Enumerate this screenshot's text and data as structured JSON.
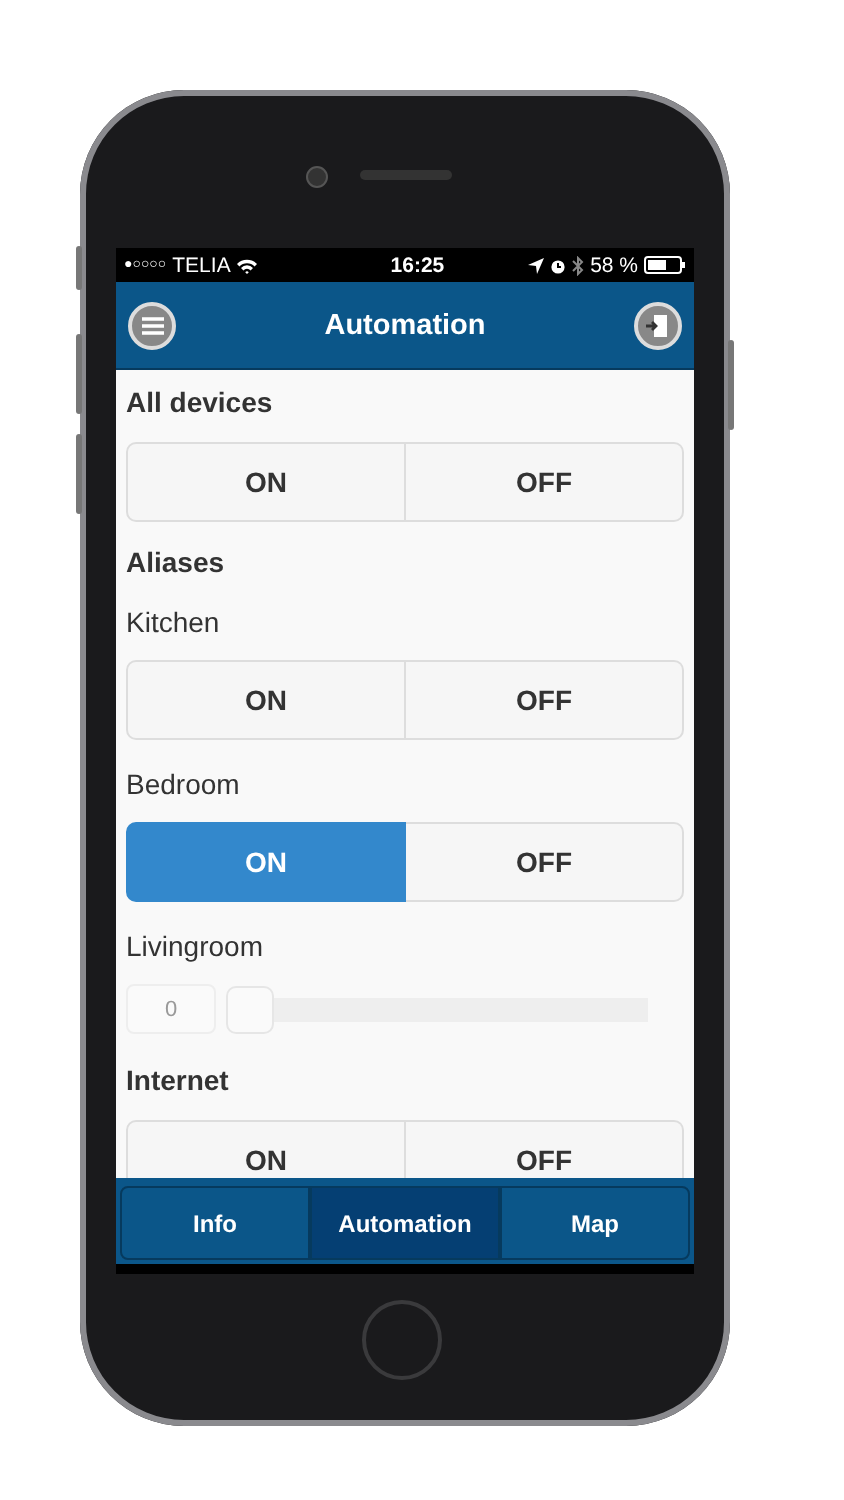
{
  "status_bar": {
    "signal": "●○○○○",
    "carrier": "TELIA",
    "time": "16:25",
    "battery": "58 %"
  },
  "header": {
    "title": "Automation"
  },
  "items": [
    {
      "kind": "heading",
      "text": "All devices"
    },
    {
      "kind": "toggle",
      "buttons": [
        {
          "label": "ON",
          "selected": false
        },
        {
          "label": "OFF",
          "selected": false
        }
      ]
    },
    {
      "kind": "heading",
      "text": "Aliases"
    },
    {
      "kind": "label",
      "text": "Kitchen"
    },
    {
      "kind": "toggle",
      "buttons": [
        {
          "label": "ON",
          "selected": false
        },
        {
          "label": "OFF",
          "selected": false
        }
      ]
    },
    {
      "kind": "label",
      "text": "Bedroom"
    },
    {
      "kind": "toggle",
      "buttons": [
        {
          "label": "ON",
          "selected": true
        },
        {
          "label": "OFF",
          "selected": false
        }
      ]
    },
    {
      "kind": "label",
      "text": "Livingroom"
    },
    {
      "kind": "slider",
      "value": "0",
      "level": 0
    },
    {
      "kind": "heading",
      "text": "Internet"
    },
    {
      "kind": "toggle",
      "buttons": [
        {
          "label": "ON",
          "selected": false
        },
        {
          "label": "OFF",
          "selected": false
        }
      ]
    }
  ],
  "tabs": [
    {
      "label": "Info",
      "selected": false
    },
    {
      "label": "Automation",
      "selected": true
    },
    {
      "label": "Map",
      "selected": false
    }
  ]
}
